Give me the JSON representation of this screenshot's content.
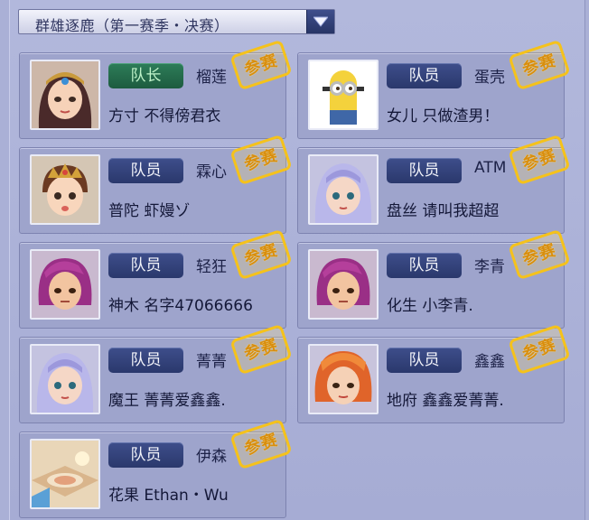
{
  "selector": {
    "label": "群雄逐鹿（第一赛季・决赛）"
  },
  "stamp_label": "参赛",
  "members": [
    {
      "role": "队长",
      "nickname": "榴莲",
      "school": "方寸",
      "name": "不得傍君衣",
      "is_leader": true,
      "avatar": "female-headpiece"
    },
    {
      "role": "队员",
      "nickname": "蛋壳",
      "school": "女儿",
      "name": "只做渣男！",
      "is_leader": false,
      "avatar": "minion"
    },
    {
      "role": "队员",
      "nickname": "霖心",
      "school": "普陀",
      "name": "虾嫚ゾ",
      "is_leader": false,
      "avatar": "boy-crown"
    },
    {
      "role": "队员",
      "nickname": "ATM",
      "school": "盘丝",
      "name": "请叫我超超",
      "is_leader": false,
      "avatar": "silver-hair"
    },
    {
      "role": "队员",
      "nickname": "轻狂",
      "school": "神木",
      "name": "名字47066666",
      "is_leader": false,
      "avatar": "purple-hair"
    },
    {
      "role": "队员",
      "nickname": "李青",
      "school": "化生",
      "name": "小李青.",
      "is_leader": false,
      "avatar": "purple-hair"
    },
    {
      "role": "队员",
      "nickname": "菁菁",
      "school": "魔王",
      "name": "菁菁爱鑫鑫.",
      "is_leader": false,
      "avatar": "silver-hair"
    },
    {
      "role": "队员",
      "nickname": "鑫鑫",
      "school": "地府",
      "name": "鑫鑫爱菁菁.",
      "is_leader": false,
      "avatar": "orange-hair"
    },
    {
      "role": "队员",
      "nickname": "伊森",
      "school": "花果",
      "name": "Ethan・Wu",
      "is_leader": false,
      "avatar": "scenery"
    }
  ],
  "colors": {
    "leader_role_text": "#bff3c9",
    "stamp": "#f5c21b"
  }
}
